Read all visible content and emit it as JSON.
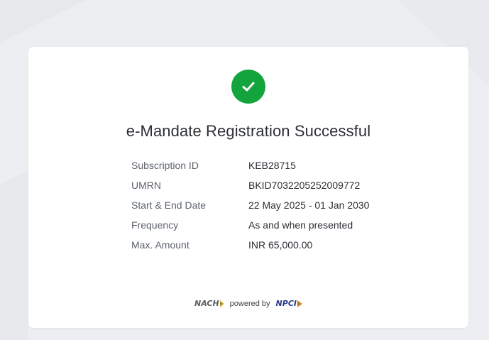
{
  "title": "e-Mandate Registration Successful",
  "details": [
    {
      "label": "Subscription ID",
      "value": "KEB28715"
    },
    {
      "label": "UMRN",
      "value": "BKID7032205252009772"
    },
    {
      "label": "Start & End Date",
      "value": "22 May 2025 - 01 Jan 2030"
    },
    {
      "label": "Frequency",
      "value": "As and when presented"
    },
    {
      "label": "Max. Amount",
      "value": "INR 65,000.00"
    }
  ],
  "footer": {
    "nach_logo": "NACH",
    "powered_by": "powered by",
    "npci_logo": "NPCI"
  },
  "colors": {
    "success": "#14a43d",
    "page_bg": "#eceef1",
    "card_bg": "#ffffff"
  },
  "icons": {
    "status": "check-icon"
  }
}
